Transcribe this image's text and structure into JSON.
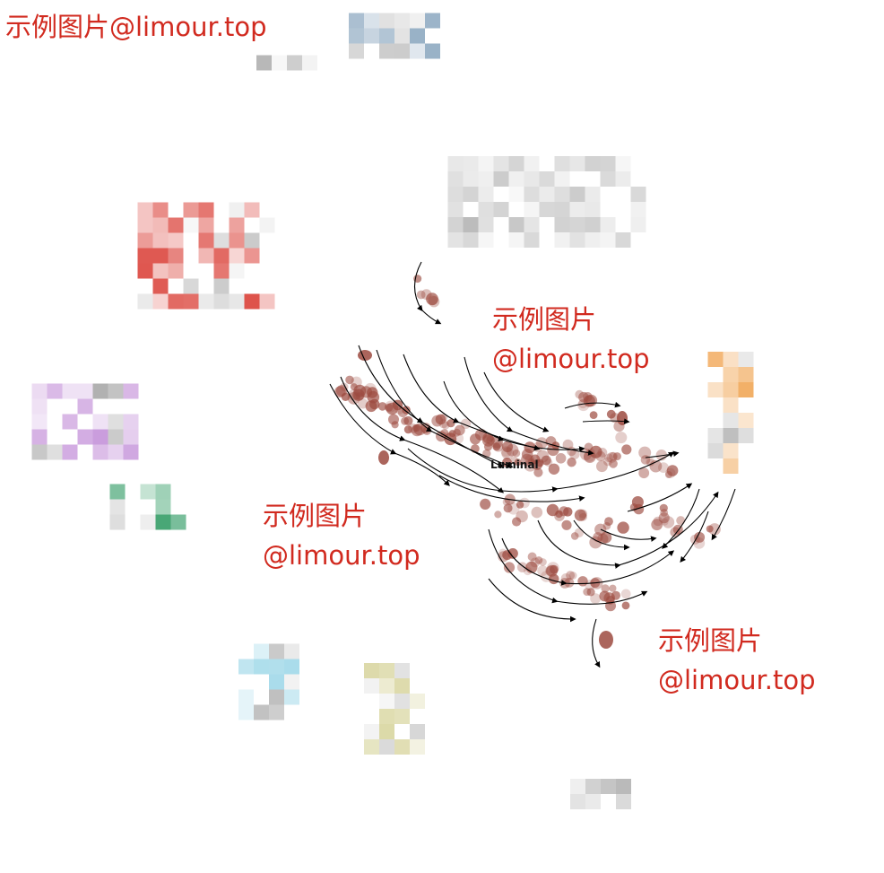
{
  "watermarks": {
    "w1": "示例图片@limour.top",
    "w2_line1": "示例图片",
    "w2_line2": "@limour.top",
    "w3_line1": "示例图片",
    "w3_line2": "@limour.top",
    "w4_line1": "示例图片",
    "w4_line2": "@limour.top"
  },
  "chart_data": {
    "type": "scatter",
    "title": "",
    "xlabel": "",
    "ylabel": "",
    "grid": false,
    "legend": "none",
    "annotations": [
      {
        "text": "Luminal"
      }
    ],
    "highlighted_cluster": {
      "name": "Luminal",
      "color": "#9c4a3f",
      "overlay": "velocity streamlines with arrowheads"
    },
    "background_clusters_colors": [
      "#d73027",
      "#c38fd8",
      "#2e9a62",
      "#9fd8e8",
      "#d6d39a",
      "#f0a24e",
      "#6b8fae"
    ],
    "background_clusters_pixelated": true
  }
}
